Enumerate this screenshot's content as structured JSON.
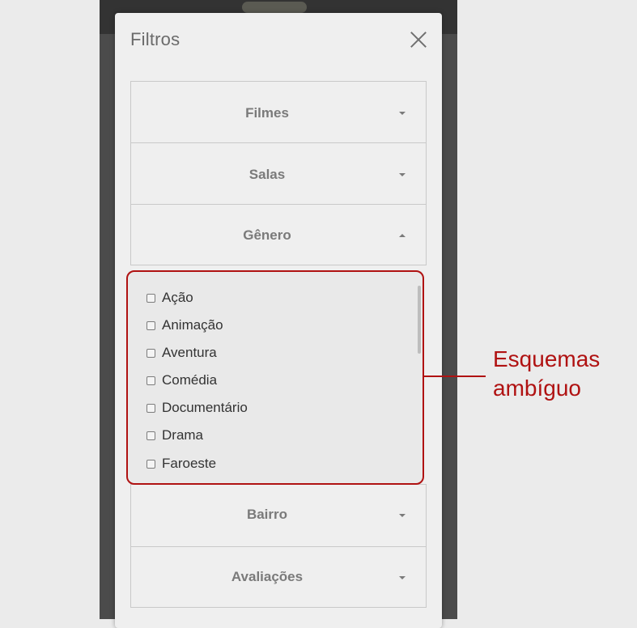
{
  "modal": {
    "title": "Filtros"
  },
  "accordions": [
    {
      "label": "Filmes",
      "expanded": false
    },
    {
      "label": "Salas",
      "expanded": false
    },
    {
      "label": "Gênero",
      "expanded": true
    },
    {
      "label": "Bairro",
      "expanded": false
    },
    {
      "label": "Avaliações",
      "expanded": false
    }
  ],
  "genres": [
    "Ação",
    "Animação",
    "Aventura",
    "Comédia",
    "Documentário",
    "Drama",
    "Faroeste"
  ],
  "annotation": {
    "line1": "Esquemas",
    "line2": "ambíguo",
    "color": "#b01212"
  },
  "icons": {
    "close": "close-icon",
    "caret_down": "chevron-down-icon",
    "caret_up": "chevron-up-icon"
  }
}
